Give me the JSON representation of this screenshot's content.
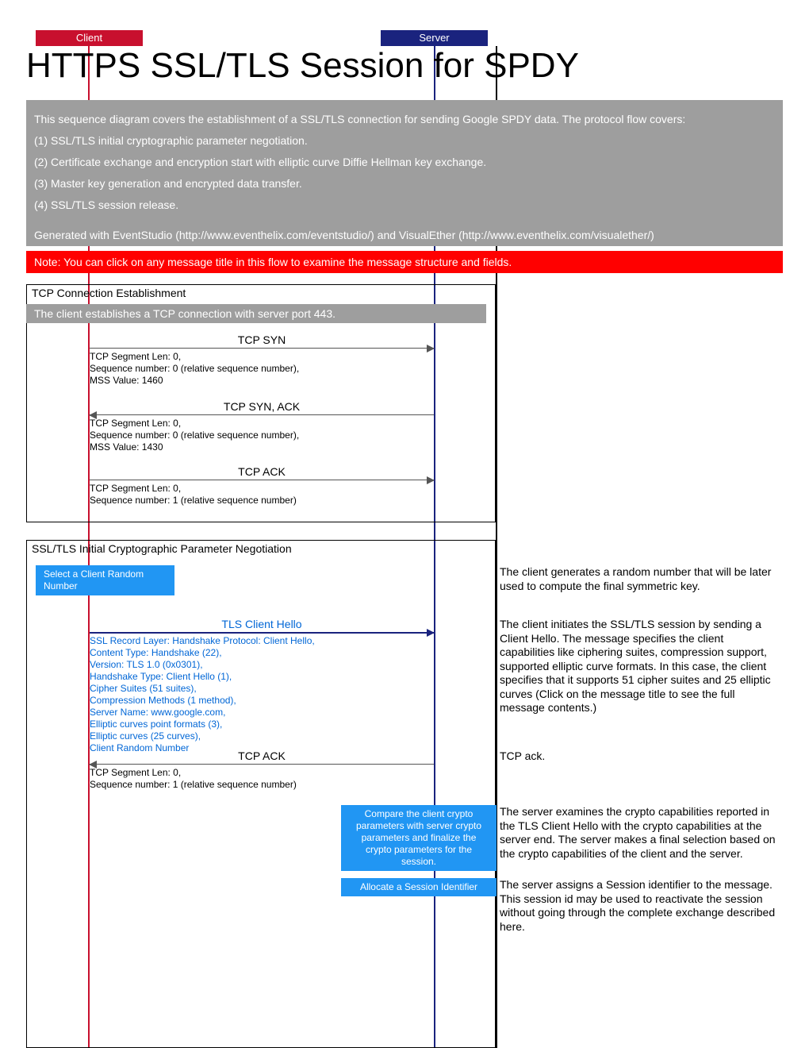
{
  "header": {
    "client_label": "Client",
    "server_label": "Server",
    "title": "HTTPS SSL/TLS Session for SPDY"
  },
  "description": {
    "intro": "This sequence diagram covers the establishment of a SSL/TLS connection for sending Google SPDY data. The protocol flow covers:",
    "items": [
      "(1) SSL/TLS initial cryptographic parameter negotiation.",
      "(2) Certificate exchange and encryption start with elliptic curve Diffie Hellman key exchange.",
      "(3) Master key generation and encrypted data transfer.",
      "(4) SSL/TLS session release."
    ],
    "generated": "Generated with EventStudio (http://www.eventhelix.com/eventstudio/) and  VisualEther (http://www.eventhelix.com/visualether/)",
    "note": "Note: You can click on any message title in this flow to examine the message structure and fields."
  },
  "sections": {
    "tcp": {
      "title": "TCP Connection Establishment",
      "note": "The client establishes a TCP connection with server port 443."
    },
    "ssl": {
      "title": "SSL/TLS Initial Cryptographic Parameter Negotiation"
    }
  },
  "messages": {
    "tcp_syn": {
      "label": "TCP SYN",
      "detail": "TCP Segment Len: 0,\nSequence number: 0 (relative sequence number),\nMSS Value: 1460"
    },
    "tcp_syn_ack": {
      "label": "TCP SYN, ACK",
      "detail": "TCP Segment Len: 0,\nSequence number: 0 (relative sequence number),\nMSS Value: 1430"
    },
    "tcp_ack1": {
      "label": "TCP ACK",
      "detail": "TCP Segment Len: 0,\nSequence number: 1 (relative sequence number)"
    },
    "client_random": {
      "action": "Select a Client Random Number",
      "side": "The client generates a random number that will be later used to compute the final symmetric key."
    },
    "tls_hello": {
      "label": "TLS Client Hello",
      "detail": "SSL Record Layer: Handshake Protocol: Client Hello,\nContent Type: Handshake (22),\nVersion: TLS 1.0 (0x0301),\nHandshake Type: Client Hello (1),\nCipher Suites (51 suites),\nCompression Methods (1 method),\nServer Name: www.google.com,\nElliptic curves point formats (3),\nElliptic curves (25 curves),\nClient Random Number",
      "side": "The client initiates the SSL/TLS session by sending a Client Hello. The message specifies the client capabilities like ciphering suites, compression support, supported elliptic curve formats. In this case, the client specifies that it supports 51 cipher suites and 25 elliptic curves (Click on the message title to see the full message contents.)"
    },
    "tcp_ack2": {
      "label": "TCP ACK",
      "detail": "TCP Segment Len: 0,\nSequence number: 1 (relative sequence number)",
      "side": "TCP ack."
    },
    "compare": {
      "action": "Compare the client crypto parameters with server crypto parameters and finalize the crypto parameters for the session.",
      "side": "The server examines the crypto capabilities reported in the TLS Client Hello with the crypto capabilities at the server end. The server makes a final selection based on the crypto capabilities of the client and the server."
    },
    "allocate": {
      "action": "Allocate a Session Identifier",
      "side": "The server assigns a Session identifier to the message. This session id may be used to reactivate the session without going through the complete exchange described here."
    }
  }
}
